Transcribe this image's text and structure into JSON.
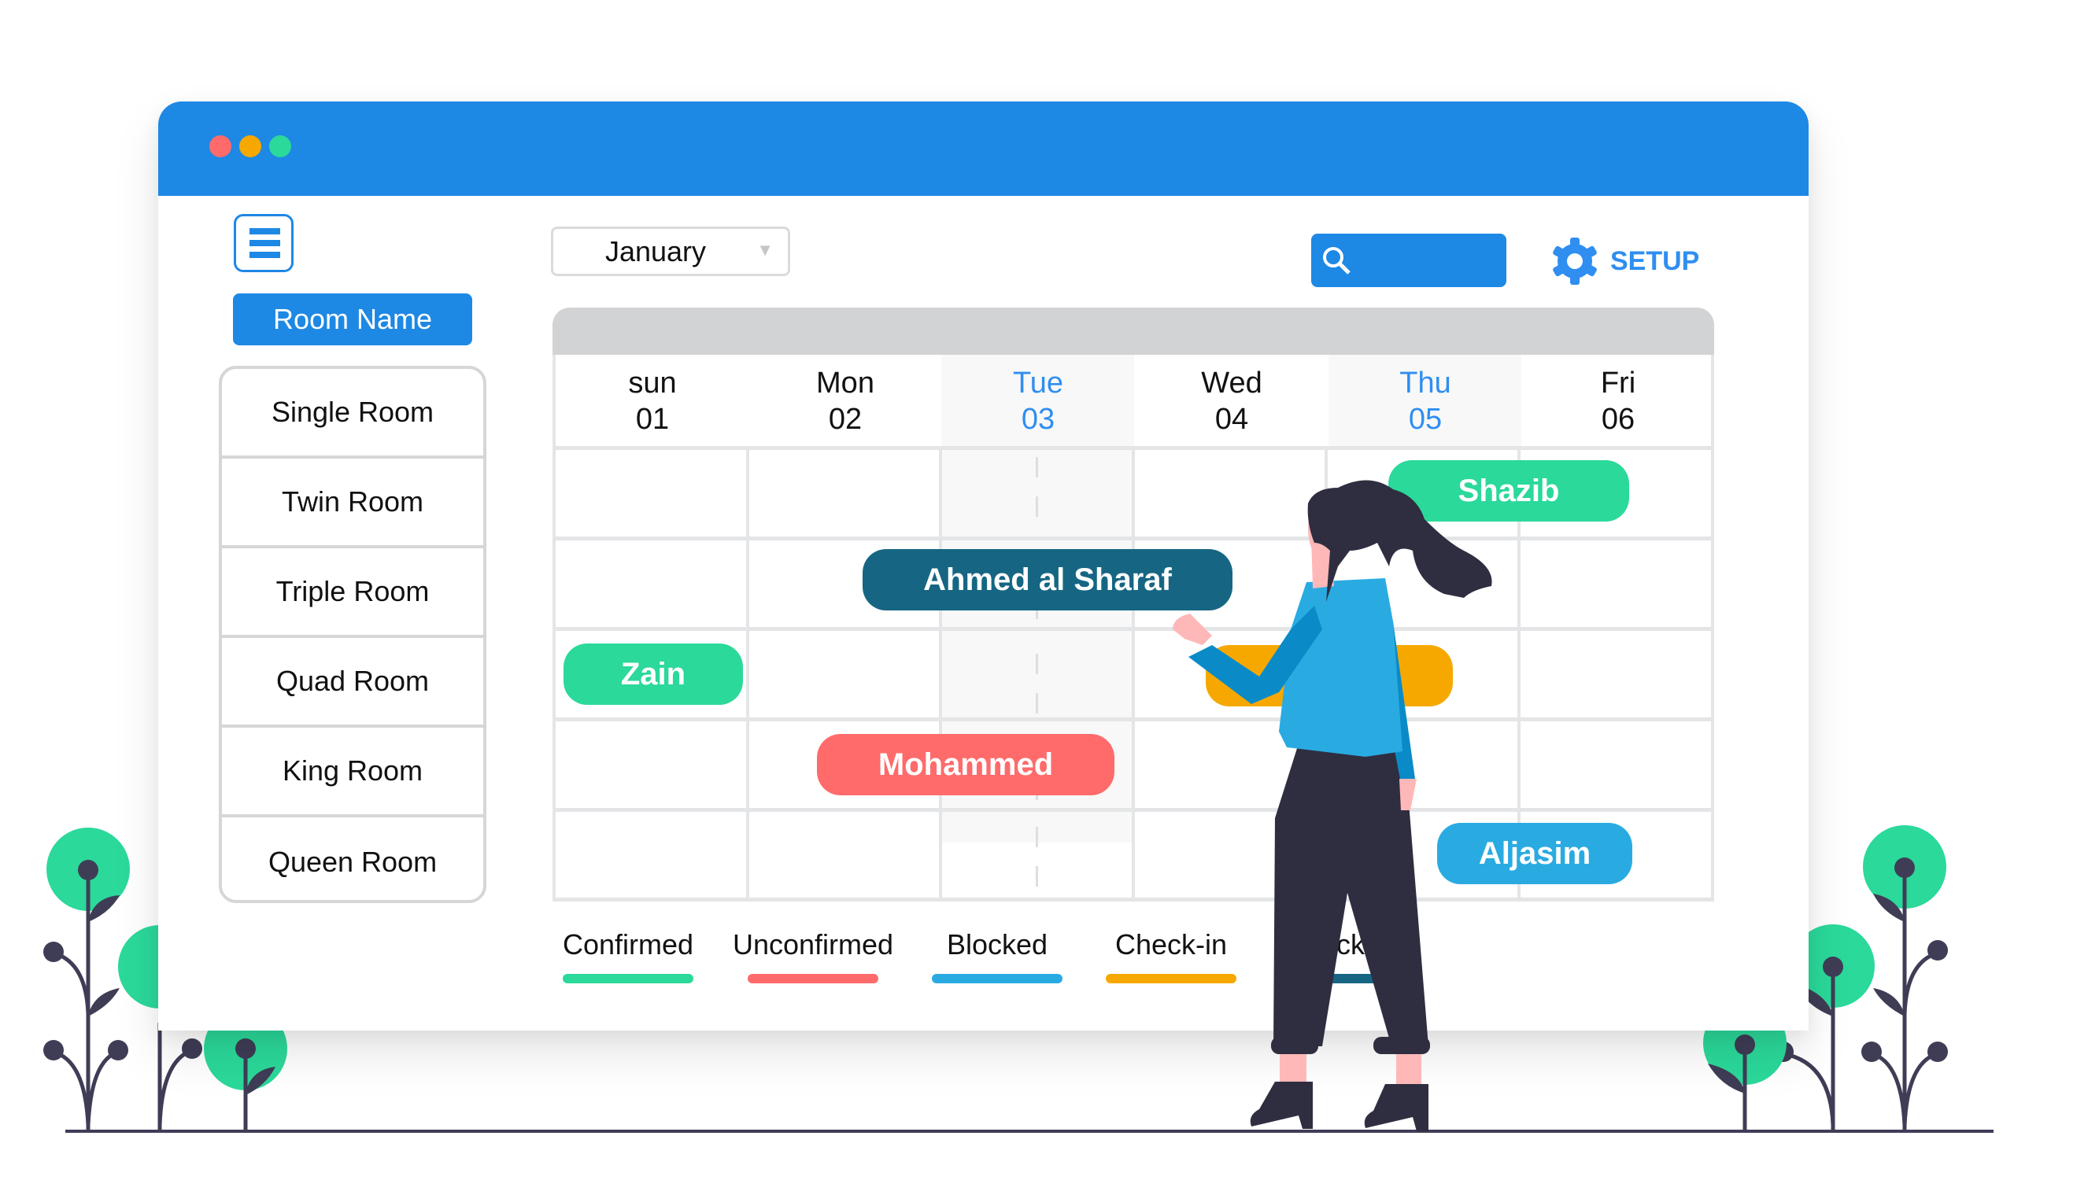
{
  "window": {
    "controls": [
      {
        "name": "close",
        "color": "#FF6B6B"
      },
      {
        "name": "minimize",
        "color": "#F6A800"
      },
      {
        "name": "maximize",
        "color": "#2BD99A"
      }
    ]
  },
  "sidebar": {
    "menu_icon": "hamburger-icon",
    "header_label": "Room Name",
    "rooms": [
      "Single Room",
      "Twin Room",
      "Triple Room",
      "Quad Room",
      "King Room",
      "Queen Room"
    ]
  },
  "toolbar": {
    "month": "January",
    "search_placeholder": "",
    "search_icon": "search-icon",
    "setup_icon": "gear-icon",
    "setup_label": "SETUP"
  },
  "calendar": {
    "days": [
      {
        "name": "sun",
        "date": "01",
        "highlighted": false
      },
      {
        "name": "Mon",
        "date": "02",
        "highlighted": false
      },
      {
        "name": "Tue",
        "date": "03",
        "highlighted": true
      },
      {
        "name": "Wed",
        "date": "04",
        "highlighted": false
      },
      {
        "name": "Thu",
        "date": "05",
        "highlighted": true
      },
      {
        "name": "Fri",
        "date": "06",
        "highlighted": false
      }
    ],
    "bookings": [
      {
        "guest": "Shazib",
        "room": "Single Room",
        "status": "Confirmed"
      },
      {
        "guest": "Ahmed al Sharaf",
        "room": "Twin Room",
        "status": "Check-out"
      },
      {
        "guest": "Zain",
        "room": "Triple Room",
        "status": "Confirmed"
      },
      {
        "guest": "",
        "room": "Triple Room",
        "status": "Check-in"
      },
      {
        "guest": "Mohammed",
        "room": "Quad Room",
        "status": "Unconfirmed"
      },
      {
        "guest": "Aljasim",
        "room": "King Room",
        "status": "Blocked"
      }
    ]
  },
  "legend": [
    {
      "label": "Confirmed",
      "color": "#2BD99A"
    },
    {
      "label": "Unconfirmed",
      "color": "#FF6B6B"
    },
    {
      "label": "Blocked",
      "color": "#29ABE2"
    },
    {
      "label": "Check-in",
      "color": "#F6A800"
    },
    {
      "label": "Check-out",
      "color": "#166683"
    }
  ],
  "colors": {
    "accent": "#1E88E5",
    "highlight_text": "#2F8EF0",
    "plant_green": "#2BD99A",
    "plant_stem": "#3F3D56"
  }
}
